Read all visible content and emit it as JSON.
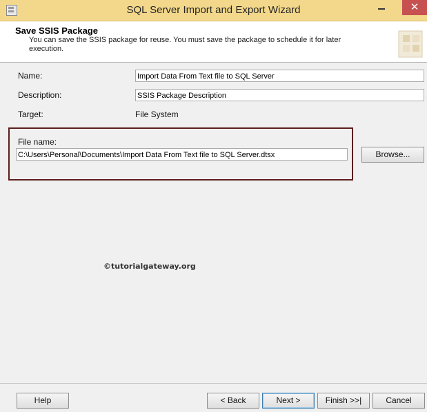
{
  "window": {
    "title": "SQL Server Import and Export Wizard",
    "close_glyph": "✕"
  },
  "header": {
    "title": "Save SSIS Package",
    "description": "You can save the SSIS package for reuse. You must save the package to schedule it for later execution."
  },
  "form": {
    "name_label": "Name:",
    "name_value": "Import Data From Text file to SQL Server",
    "description_label": "Description:",
    "description_value": "SSIS Package Description",
    "target_label": "Target:",
    "target_value": "File System",
    "file_name_label": "File name:",
    "file_name_value": "C:\\Users\\Personal\\Documents\\Import Data From Text file to SQL Server.dtsx",
    "browse_label": "Browse..."
  },
  "watermark": "©tutorialgateway.org",
  "footer": {
    "help_label": "Help",
    "back_label": "< Back",
    "next_label": "Next >",
    "finish_label": "Finish >>|",
    "cancel_label": "Cancel"
  },
  "colors": {
    "titlebar": "#f3d88b",
    "highlight_border": "#5b1d1d",
    "close_button": "#c75050"
  }
}
